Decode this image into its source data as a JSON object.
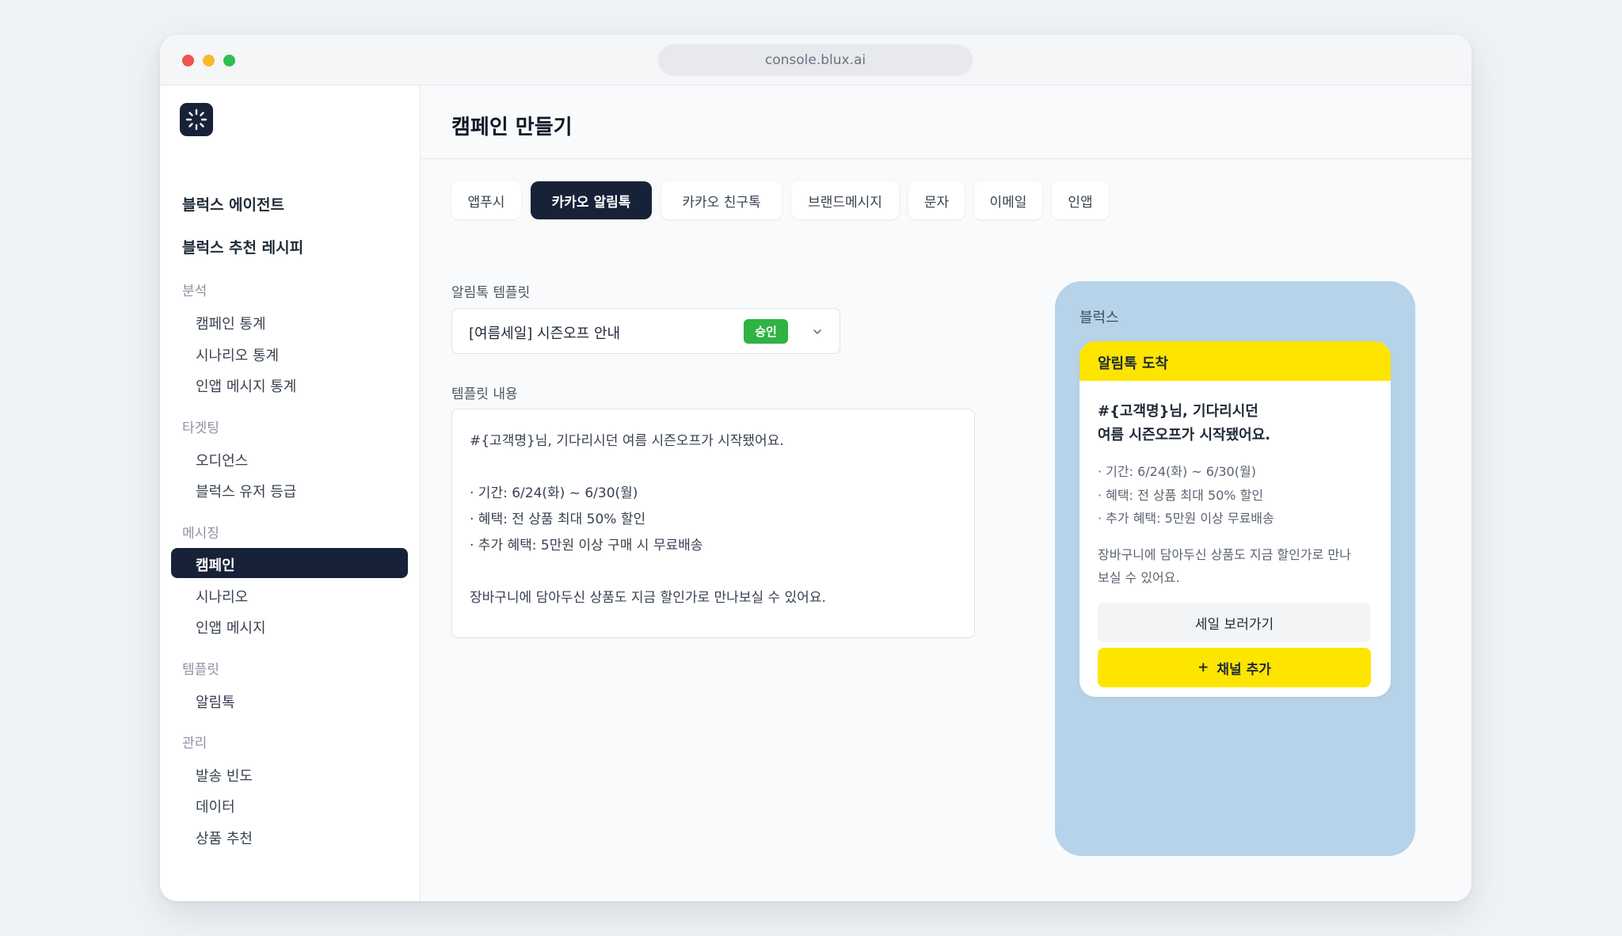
{
  "browser": {
    "url": "console.blux.ai"
  },
  "sidebar": {
    "top_items": [
      "블럭스 에이전트",
      "블럭스 추천 레시피"
    ],
    "groups": [
      {
        "title": "분석",
        "items": [
          "캠페인 통계",
          "시나리오 통계",
          "인앱 메시지 통계"
        ]
      },
      {
        "title": "타겟팅",
        "items": [
          "오디언스",
          "블럭스 유저 등급"
        ]
      },
      {
        "title": "메시징",
        "items": [
          "캠페인",
          "시나리오",
          "인앱 메시지"
        ]
      },
      {
        "title": "템플릿",
        "items": [
          "알림톡"
        ]
      },
      {
        "title": "관리",
        "items": [
          "발송 빈도",
          "데이터",
          "상품 추천"
        ]
      }
    ],
    "active_item": "캠페인"
  },
  "main": {
    "title": "캠페인 만들기",
    "tabs": [
      "앱푸시",
      "카카오 알림톡",
      "카카오 친구톡",
      "브랜드메시지",
      "문자",
      "이메일",
      "인앱"
    ],
    "active_tab": "카카오 알림톡",
    "template_label": "알림톡 템플릿",
    "template_value": "[여름세일] 시즌오프 안내",
    "template_status": "승인",
    "content_label": "템플릿 내용",
    "content_lines": [
      "#{고객명}님, 기다리시던 여름 시즌오프가 시작됐어요.",
      "",
      "· 기간: 6/24(화) ~ 6/30(월)",
      "· 혜택: 전 상품 최대 50% 할인",
      "· 추가 혜택: 5만원 이상 구매 시 무료배송",
      "",
      "장바구니에 담아두신 상품도 지금 할인가로 만나보실 수 있어요."
    ]
  },
  "preview": {
    "sender": "블럭스",
    "header": "알림톡 도착",
    "title_lines": [
      "#{고객명}님, 기다리시던",
      "여름 시즌오프가 시작됐어요."
    ],
    "bullets": [
      "· 기간: 6/24(화) ~ 6/30(월)",
      "· 혜택: 전 상품 최대 50% 할인",
      "· 추가 혜택: 5만원 이상 무료배송"
    ],
    "body_lines": [
      "장바구니에 담아두신 상품도 지금 할인가로 만나",
      "보실 수 있어요."
    ],
    "button_primary": "세일 보러가기",
    "button_add_icon": "+",
    "button_add": "채널 추가"
  },
  "colors": {
    "navy": "#172238",
    "kakao_yellow": "#fee500",
    "approved_green": "#2fb344",
    "preview_bg": "#b6d3e9"
  },
  "icons": [
    "logo-icon",
    "chevron-down-icon",
    "plus-icon"
  ]
}
